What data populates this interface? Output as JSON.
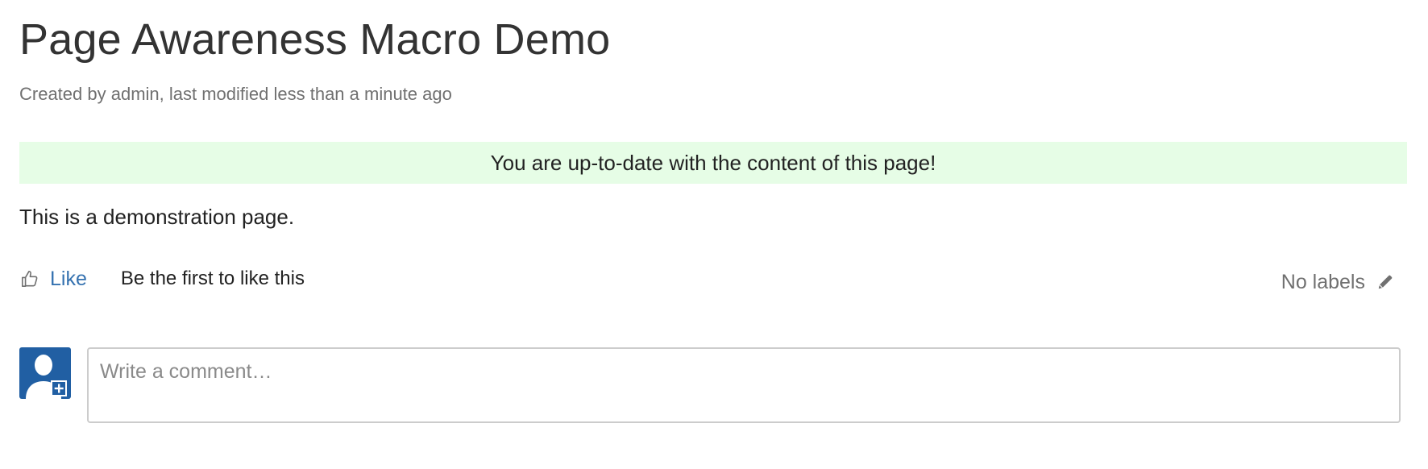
{
  "page": {
    "title": "Page Awareness Macro Demo",
    "metadata": "Created by admin, last modified less than a minute ago"
  },
  "awareness_banner": {
    "message": "You are up-to-date with the content of this page!",
    "background_color": "#e6fde6"
  },
  "content": {
    "body_text": "This is a demonstration page."
  },
  "likes": {
    "icon": "thumbs-up-icon",
    "like_label": "Like",
    "summary": "Be the first to like this"
  },
  "labels": {
    "text": "No labels",
    "edit_icon": "pencil-icon"
  },
  "comment": {
    "avatar_icon": "user-add-avatar-icon",
    "placeholder": "Write a comment…"
  },
  "colors": {
    "link": "#3572b0",
    "avatar_bg": "#215fa3",
    "muted_text": "#707070"
  }
}
